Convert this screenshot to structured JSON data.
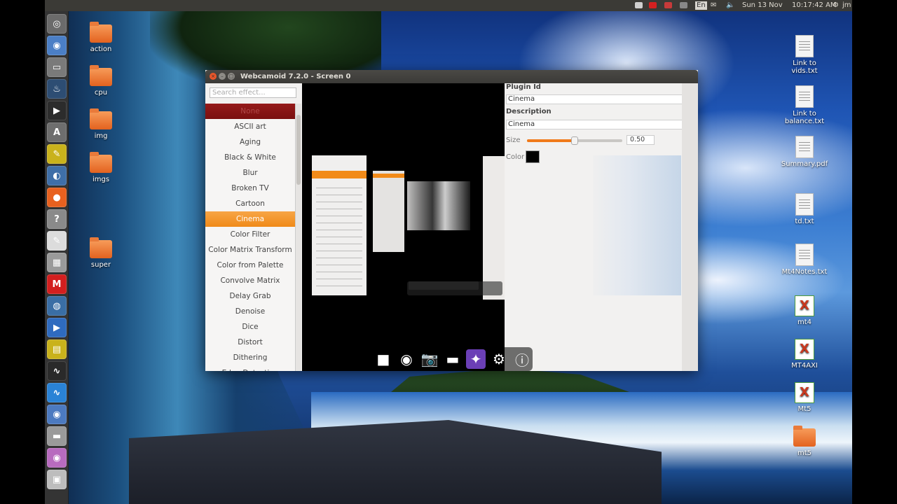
{
  "panel": {
    "keyboard": "En",
    "date": "Sun 13 Nov",
    "time": "10:17:42 AM",
    "user": "jm"
  },
  "launcher": [
    {
      "name": "ubuntu-dash-icon",
      "glyph": "◎",
      "color": "#6b6b6b"
    },
    {
      "name": "browser-icon",
      "glyph": "◉",
      "color": "#4b7fc6"
    },
    {
      "name": "keyboard-icon",
      "glyph": "▭",
      "color": "#7a7a7a"
    },
    {
      "name": "steam-icon",
      "glyph": "♨",
      "color": "#2d4d73"
    },
    {
      "name": "terminal-icon",
      "glyph": "▶",
      "color": "#2c2c2c"
    },
    {
      "name": "software-center-icon",
      "glyph": "A",
      "color": "#6e6e6e"
    },
    {
      "name": "notes-icon",
      "glyph": "✎",
      "color": "#c9b21c"
    },
    {
      "name": "app-icon",
      "glyph": "◐",
      "color": "#3f6fa8"
    },
    {
      "name": "firefox-icon",
      "glyph": "●",
      "color": "#e8611f"
    },
    {
      "name": "unknown-app-icon",
      "glyph": "?",
      "color": "#8a8a8a"
    },
    {
      "name": "text-editor-icon",
      "glyph": "✎",
      "color": "#dcdcdc"
    },
    {
      "name": "calculator-icon",
      "glyph": "▦",
      "color": "#9a9a9a"
    },
    {
      "name": "mega-icon",
      "glyph": "M",
      "color": "#d31f1f"
    },
    {
      "name": "earth-icon",
      "glyph": "◍",
      "color": "#3a6ea5"
    },
    {
      "name": "media-player-icon",
      "glyph": "▶",
      "color": "#2f6bbf"
    },
    {
      "name": "presentation-icon",
      "glyph": "▤",
      "color": "#c9b21c"
    },
    {
      "name": "system-monitor-icon",
      "glyph": "∿",
      "color": "#2a2a2a"
    },
    {
      "name": "wave-app-icon",
      "glyph": "∿",
      "color": "#2a83d6"
    },
    {
      "name": "chromium-icon",
      "glyph": "◉",
      "color": "#4c7ac0"
    },
    {
      "name": "drive-icon",
      "glyph": "▬",
      "color": "#9a9a9a"
    },
    {
      "name": "webcam-app-icon",
      "glyph": "◉",
      "color": "#b86bbf"
    },
    {
      "name": "printer-icon",
      "glyph": "▣",
      "color": "#bdbdbd"
    }
  ],
  "desktop_left": [
    {
      "label": "action"
    },
    {
      "label": "cpu"
    },
    {
      "label": "img"
    },
    {
      "label": "imgs"
    },
    {
      "label": "super"
    }
  ],
  "desktop_right": [
    {
      "label": "Link to vids.txt",
      "kind": "file"
    },
    {
      "label": "Link to balance.txt",
      "kind": "file"
    },
    {
      "label": "Summary.pdf",
      "kind": "file"
    },
    {
      "label": "td.txt",
      "kind": "file"
    },
    {
      "label": "Mt4Notes.txt",
      "kind": "file"
    },
    {
      "label": "mt4",
      "kind": "mt"
    },
    {
      "label": "MT4AXI",
      "kind": "mt"
    },
    {
      "label": "Mt5",
      "kind": "mt"
    },
    {
      "label": "mt5",
      "kind": "folder"
    }
  ],
  "window": {
    "title": "Webcamoid 7.2.0 - Screen 0",
    "search_placeholder": "Search effect...",
    "effects": [
      "None",
      "ASCII art",
      "Aging",
      "Black & White",
      "Blur",
      "Broken TV",
      "Cartoon",
      "Cinema",
      "Color Filter",
      "Color Matrix Transform",
      "Color from Palette",
      "Convolve Matrix",
      "Delay Grab",
      "Denoise",
      "Dice",
      "Distort",
      "Dithering",
      "Edge Detection"
    ],
    "selected_effect": "Cinema",
    "props": {
      "plugin_id_label": "Plugin Id",
      "plugin_id_value": "Cinema",
      "description_label": "Description",
      "description_value": "Cinema",
      "size_label": "Size",
      "size_value": "0.50",
      "size_fraction": 0.5,
      "color_label": "Color",
      "color_value": "#000000"
    }
  },
  "toolbar": [
    {
      "name": "stop-button",
      "glyph": "■"
    },
    {
      "name": "webcam-button",
      "glyph": "◉"
    },
    {
      "name": "take-photo-button",
      "glyph": "📷"
    },
    {
      "name": "record-video-button",
      "glyph": "▬"
    },
    {
      "name": "effects-button",
      "glyph": "✦",
      "active": true
    },
    {
      "name": "settings-button",
      "glyph": "⚙"
    },
    {
      "name": "about-button",
      "glyph": "ⓘ"
    }
  ]
}
